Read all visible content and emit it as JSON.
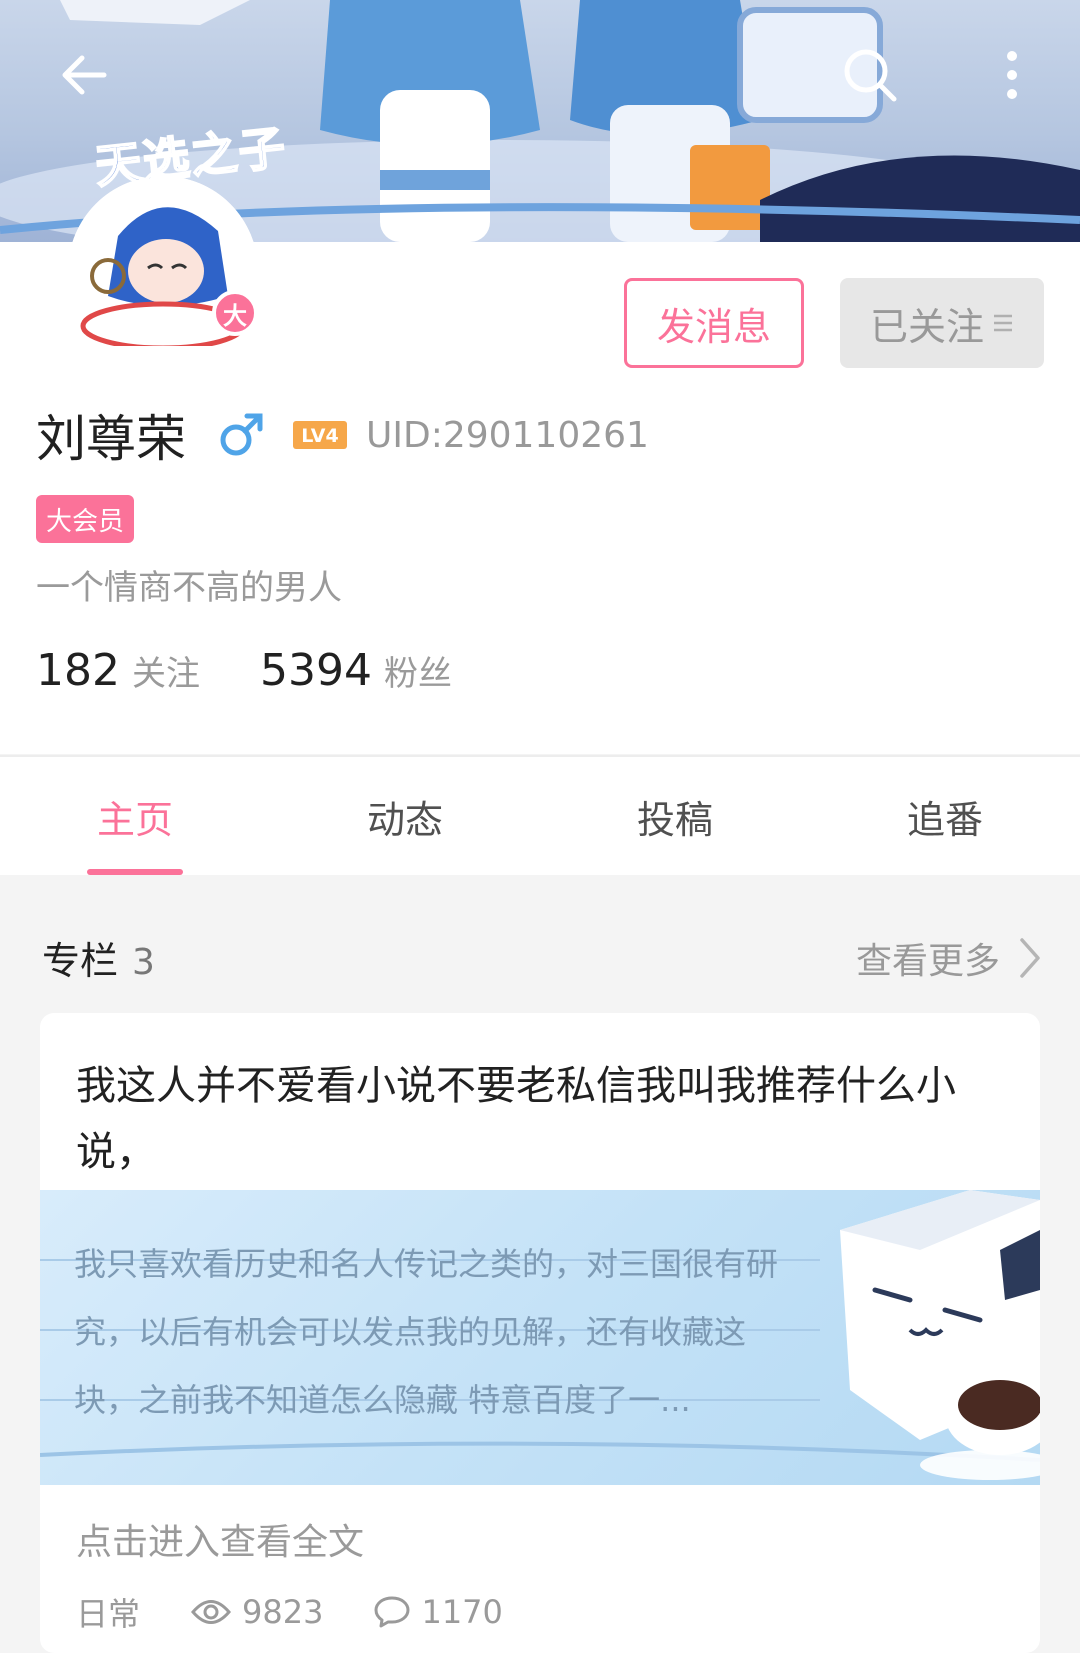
{
  "topbar": {
    "back_icon": "arrow-left-icon",
    "search_icon": "search-icon",
    "more_icon": "more-vertical-icon"
  },
  "avatar": {
    "badge_text": "天选之子",
    "vip_mark": "大"
  },
  "actions": {
    "message_label": "发消息",
    "follow_label": "已关注"
  },
  "user": {
    "name": "刘尊荣",
    "gender_icon": "male-icon",
    "level": "LV4",
    "uid": "UID:290110261",
    "vip_badge": "大会员",
    "signature": "一个情商不高的男人",
    "following_count": "182",
    "following_label": "关注",
    "fans_count": "5394",
    "fans_label": "粉丝"
  },
  "tabs": [
    {
      "label": "主页",
      "active": true
    },
    {
      "label": "动态",
      "active": false
    },
    {
      "label": "投稿",
      "active": false
    },
    {
      "label": "追番",
      "active": false
    }
  ],
  "section": {
    "title": "专栏",
    "count": "3",
    "more_label": "查看更多"
  },
  "article": {
    "title": "我这人并不爱看小说不要老私信我叫我推荐什么小说，",
    "excerpt": "我只喜欢看历史和名人传记之类的，对三国很有研究，以后有机会可以发点我的见解，还有收藏这块，之前我不知道怎么隐藏 特意百度了一...",
    "read_more": "点击进入查看全文",
    "category": "日常",
    "views": "9823",
    "comments": "1170"
  },
  "colors": {
    "accent": "#fb7299",
    "text_primary": "#212121",
    "text_secondary": "#9a9a9a",
    "level_orange": "#f6a74a",
    "gender_blue": "#4fa4e8"
  }
}
